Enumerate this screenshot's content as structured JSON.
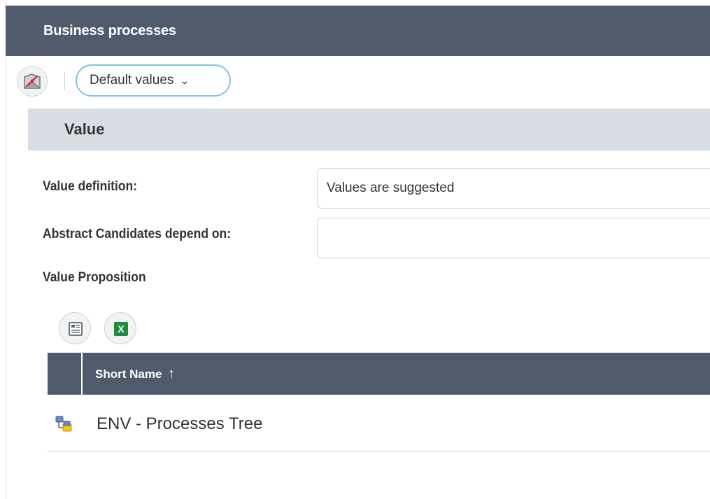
{
  "header": {
    "title": "Business processes"
  },
  "toolbar": {
    "diagram_icon": "diagram-icon",
    "dropdown_label": "Default values",
    "dropdown_icon": "chevron-down-icon"
  },
  "section": {
    "title": "Value"
  },
  "form": {
    "value_definition": {
      "label": "Value definition:",
      "value": "Values are suggested"
    },
    "abstract_candidates": {
      "label": "Abstract Candidates depend on:",
      "value": ""
    },
    "value_proposition": {
      "label": "Value Proposition"
    }
  },
  "table": {
    "toolbar": [
      {
        "icon": "report-icon"
      },
      {
        "icon": "excel-icon",
        "text": "X"
      }
    ],
    "columns": [
      {
        "label": "Short Name",
        "sort": "ascending",
        "sort_icon": "↑"
      }
    ],
    "rows": [
      {
        "icon": "process-tree-icon",
        "short_name": "ENV - Processes Tree"
      }
    ]
  },
  "colors": {
    "header_bg": "#4f5b6b",
    "section_bg": "#d9dee5",
    "dropdown_border": "#7fc4e0",
    "excel_green": "#1e8c3a"
  }
}
